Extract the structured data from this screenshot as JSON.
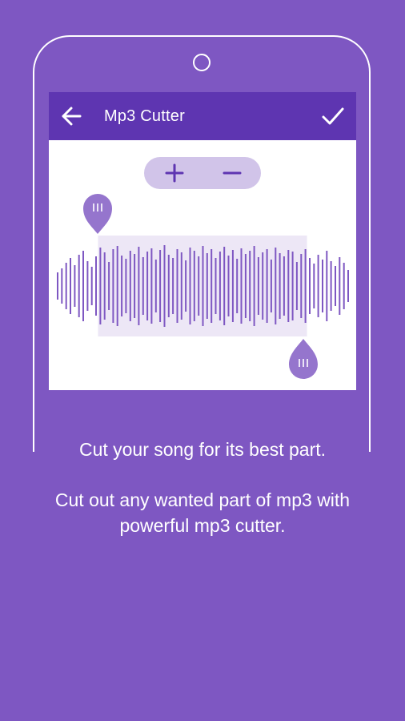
{
  "app": {
    "title": "Mp3 Cutter"
  },
  "toolbar": {
    "back_icon": "arrow-left-icon",
    "confirm_icon": "check-icon"
  },
  "zoom": {
    "in_icon": "plus-icon",
    "out_icon": "minus-icon"
  },
  "waveform": {
    "selection_start_fraction": 0.16,
    "selection_end_fraction": 0.84,
    "start_handle_icon": "marker-handle-icon",
    "end_handle_icon": "marker-handle-icon"
  },
  "captions": {
    "headline": "Cut your song for its best part.",
    "body_line1": "Cut out any wanted part of mp3 with",
    "body_line2": "powerful mp3 cutter."
  },
  "colors": {
    "background": "#7e57c2",
    "appbar": "#5e35b1",
    "accent_light": "#d1c4e9",
    "selection": "#ede7f6",
    "wave": "#7e57c2",
    "handle": "#9575cd"
  }
}
